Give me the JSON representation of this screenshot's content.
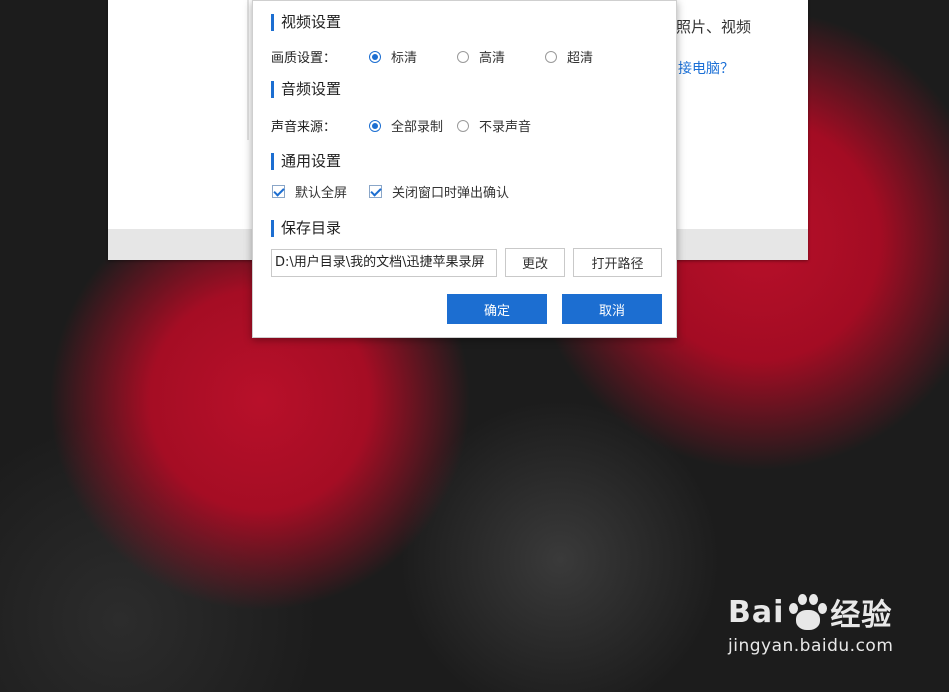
{
  "background_window": {
    "text_photos": "照片、视频",
    "text_connect": "接电脑？"
  },
  "dialog": {
    "video": {
      "title": "视频设置",
      "quality_label": "画质设置：",
      "options": [
        "标清",
        "高清",
        "超清"
      ],
      "selected": "标清"
    },
    "audio": {
      "title": "音频设置",
      "source_label": "声音来源：",
      "options": [
        "全部录制",
        "不录声音"
      ],
      "selected": "全部录制"
    },
    "general": {
      "title": "通用设置",
      "fullscreen_label": "默认全屏",
      "fullscreen_checked": true,
      "confirm_close_label": "关闭窗口时弹出确认",
      "confirm_close_checked": true
    },
    "save_dir": {
      "title": "保存目录",
      "path_value": "D:\\用户目录\\我的文档\\迅捷苹果录屏",
      "change_label": "更改",
      "open_path_label": "打开路径"
    },
    "ok_label": "确定",
    "cancel_label": "取消"
  },
  "watermark": {
    "brand": "Bai du 经验",
    "brand_left": "Bai",
    "brand_right": "经验",
    "url": "jingyan.baidu.com"
  },
  "colors": {
    "accent": "#1c6ed1",
    "dialog_bg": "#ffffff"
  }
}
